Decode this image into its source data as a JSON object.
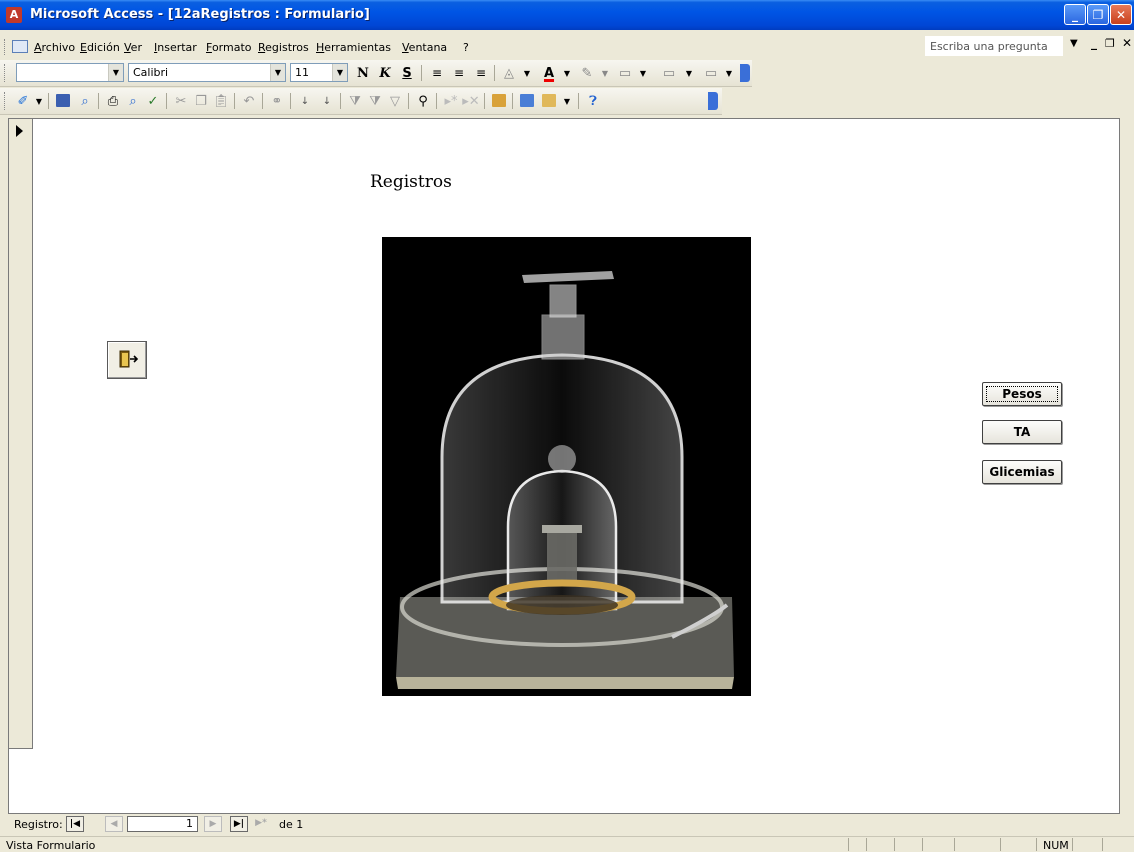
{
  "window": {
    "title": "Microsoft Access - [12aRegistros : Formulario]",
    "min_glyph": "_",
    "restore_glyph": "❐",
    "close_glyph": "✕"
  },
  "menu": {
    "items": [
      "Archivo",
      "Edición",
      "Ver",
      "Insertar",
      "Formato",
      "Registros",
      "Herramientas",
      "Ventana",
      "?"
    ],
    "ask_placeholder": "Escriba una pregunta"
  },
  "format_toolbar": {
    "object_combo": "",
    "font_name": "Calibri",
    "font_size": "11",
    "bold": "N",
    "italic": "K",
    "underline": "S"
  },
  "form": {
    "title": "Registros",
    "buttons": {
      "pesos": "Pesos",
      "ta": "TA",
      "glicemias": "Glicemias"
    }
  },
  "navigation": {
    "label": "Registro:",
    "current": "1",
    "of_text": "de 1"
  },
  "status": {
    "view": "Vista Formulario",
    "num": "NUM"
  },
  "colors": {
    "titlebar": "#0055e5",
    "chrome": "#ece9d8",
    "form_bg": "#ffffff"
  }
}
